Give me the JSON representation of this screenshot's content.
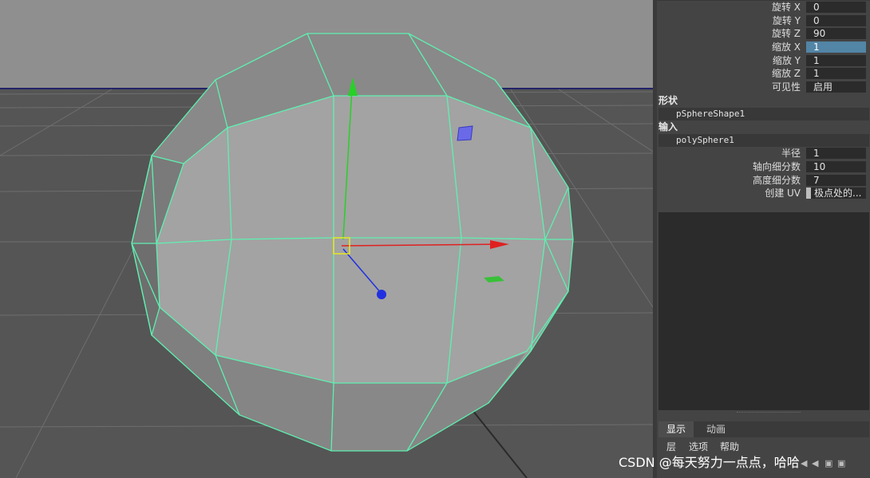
{
  "channel_box": {
    "transform_attrs": [
      {
        "label": "旋转 X",
        "value": "0"
      },
      {
        "label": "旋转 Y",
        "value": "0"
      },
      {
        "label": "旋转 Z",
        "value": "90"
      },
      {
        "label": "缩放 X",
        "value": "1"
      },
      {
        "label": "缩放 Y",
        "value": "1"
      },
      {
        "label": "缩放 Z",
        "value": "1"
      },
      {
        "label": "可见性",
        "value": "启用"
      }
    ],
    "shapes_header": "形状",
    "shape_node": "pSphereShape1",
    "inputs_header": "输入",
    "input_node": "polySphere1",
    "input_attrs": [
      {
        "label": "半径",
        "value": "1"
      },
      {
        "label": "轴向细分数",
        "value": "10"
      },
      {
        "label": "高度细分数",
        "value": "7"
      },
      {
        "label": "创建 UV",
        "value": "极点处的..."
      }
    ]
  },
  "layer_editor": {
    "tabs": [
      "显示",
      "动画"
    ],
    "active_tab": "显示",
    "menu": [
      "层",
      "选项",
      "帮助"
    ]
  },
  "viewport": {
    "selected_object": "pSphere1",
    "background_color": "#555555",
    "wireframe_color": "#5ef0b0"
  },
  "watermark": "CSDN @每天努力一点点，哈哈"
}
